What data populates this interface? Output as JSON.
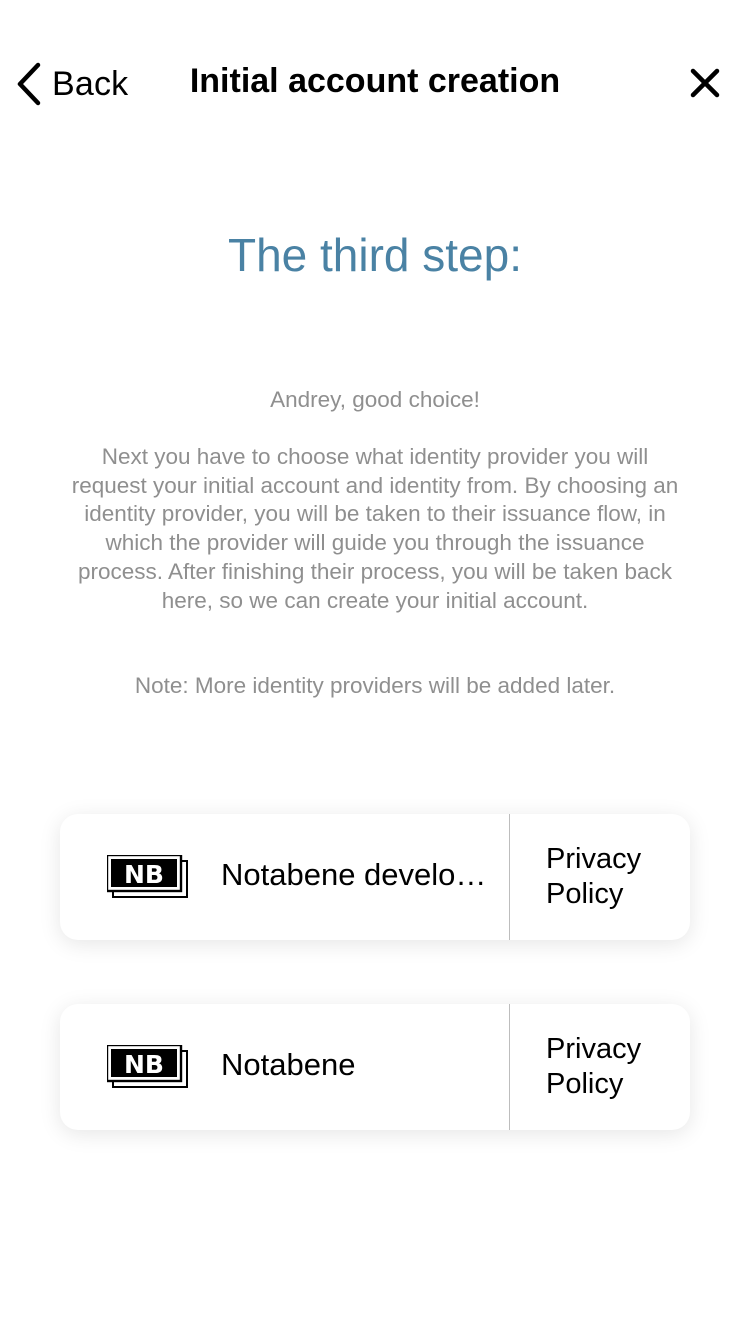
{
  "navbar": {
    "back_label": "Back",
    "title": "Initial account creation"
  },
  "step_title": "The third step:",
  "greeting": "Andrey, good choice!",
  "description": "Next you have to choose what identity provider you will request your initial account and identity from. By choosing an identity provider, you will be taken to their issuance flow, in which the provider will guide you through the issuance process. After finishing their process, you will be taken back here, so we can create your initial account.",
  "note": "Note: More identity providers will be added later.",
  "providers": [
    {
      "name": "Notabene development",
      "logo_text": "NB",
      "privacy_label": "Privacy Policy"
    },
    {
      "name": "Notabene",
      "logo_text": "NB",
      "privacy_label": "Privacy Policy"
    }
  ],
  "icons": {
    "back": "chevron-left-icon",
    "close": "close-icon",
    "provider_logo": "notabene-logo"
  },
  "colors": {
    "accent": "#4a82a4",
    "body_text": "#8f8f8f",
    "divider": "#bdbdbd"
  }
}
